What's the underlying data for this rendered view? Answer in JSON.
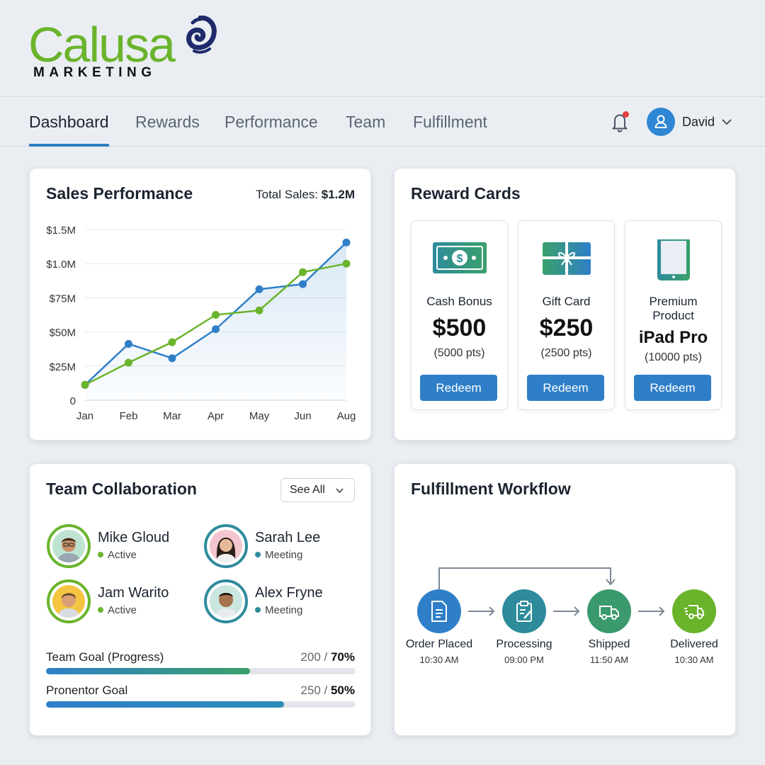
{
  "brand": {
    "name": "Calusa",
    "tagline": "MARKETING",
    "colors": {
      "green": "#6ab42c",
      "navy": "#1f2a6b"
    }
  },
  "nav": {
    "tabs": [
      "Dashboard",
      "Rewards",
      "Performance",
      "Team",
      "Fulfillment"
    ],
    "active": "Dashboard",
    "notifications_icon": "bell-icon",
    "user": {
      "name": "David"
    }
  },
  "sales": {
    "title": "Sales Performance",
    "total_label": "Total Sales:",
    "total_value": "$1.2M"
  },
  "chart_data": {
    "type": "line",
    "categories": [
      "Jan",
      "Feb",
      "Mar",
      "Apr",
      "May",
      "Jun",
      "Aug"
    ],
    "y_ticks": [
      "0",
      "$25M",
      "$50M",
      "$75M",
      "$1.0M",
      "$1.5M"
    ],
    "y_tick_values": [
      0,
      1,
      2,
      3,
      4,
      5
    ],
    "ylim": [
      0,
      5
    ],
    "grid": true,
    "series": [
      {
        "values": [
          0.45,
          1.65,
          1.23,
          2.08,
          3.25,
          3.4,
          4.62
        ],
        "color": "#2f7fc8",
        "fill": true
      },
      {
        "values": [
          0.45,
          1.1,
          1.7,
          2.5,
          2.63,
          3.75,
          4.0
        ],
        "color": "#6ab42c",
        "fill": false
      }
    ]
  },
  "rewards": {
    "title": "Reward Cards",
    "items": [
      {
        "label": "Cash Bonus",
        "value": "$500",
        "points": "(5000 pts)",
        "button": "Redeem",
        "icon": "cash-icon"
      },
      {
        "label": "Gift Card",
        "value": "$250",
        "points": "(2500 pts)",
        "button": "Redeem",
        "icon": "gift-card-icon"
      },
      {
        "label": "Premium Product",
        "value": "iPad Pro",
        "points": "(10000 pts)",
        "button": "Redeem",
        "icon": "tablet-icon"
      }
    ]
  },
  "team": {
    "title": "Team Collaboration",
    "see_all": "See All",
    "members": [
      {
        "name": "Mike Gloud",
        "status": "Active"
      },
      {
        "name": "Sarah Lee",
        "status": "Meeting"
      },
      {
        "name": "Jam Warito",
        "status": "Active"
      },
      {
        "name": "Alex Fryne",
        "status": "Meeting"
      }
    ],
    "goals": [
      {
        "label": "Team Goal (Progress)",
        "count": "200",
        "percent": "70%",
        "fill": 0.66
      },
      {
        "label": "Pronentor Goal",
        "count": "250",
        "percent": "50%",
        "fill": 0.77
      }
    ]
  },
  "fulfillment": {
    "title": "Fulfillment Workflow",
    "steps": [
      {
        "label": "Order Placed",
        "time": "10:30 AM",
        "color": "#2f7fc8",
        "icon": "document-icon"
      },
      {
        "label": "Processing",
        "time": "09:00 PM",
        "color": "#2e8b9c",
        "icon": "clipboard-icon"
      },
      {
        "label": "Shipped",
        "time": "11:50 AM",
        "color": "#3a9a6e",
        "icon": "truck-icon"
      },
      {
        "label": "Delivered",
        "time": "10:30 AM",
        "color": "#6ab42c",
        "icon": "fast-truck-icon"
      }
    ]
  }
}
